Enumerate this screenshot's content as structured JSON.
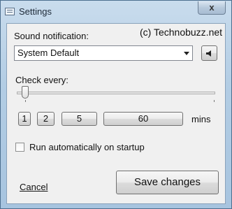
{
  "window": {
    "title": "Settings",
    "close_glyph": "x"
  },
  "credit": "(c) Technobuzz.net",
  "sound": {
    "label": "Sound notification:",
    "selected": "System Default",
    "speaker_icon": "speaker-icon"
  },
  "interval": {
    "label": "Check every:",
    "slider_value": 1,
    "presets": [
      "1",
      "2",
      "5",
      "60"
    ],
    "unit": "mins"
  },
  "startup": {
    "label": "Run automatically on startup",
    "checked": false
  },
  "actions": {
    "cancel": "Cancel",
    "save": "Save changes"
  }
}
